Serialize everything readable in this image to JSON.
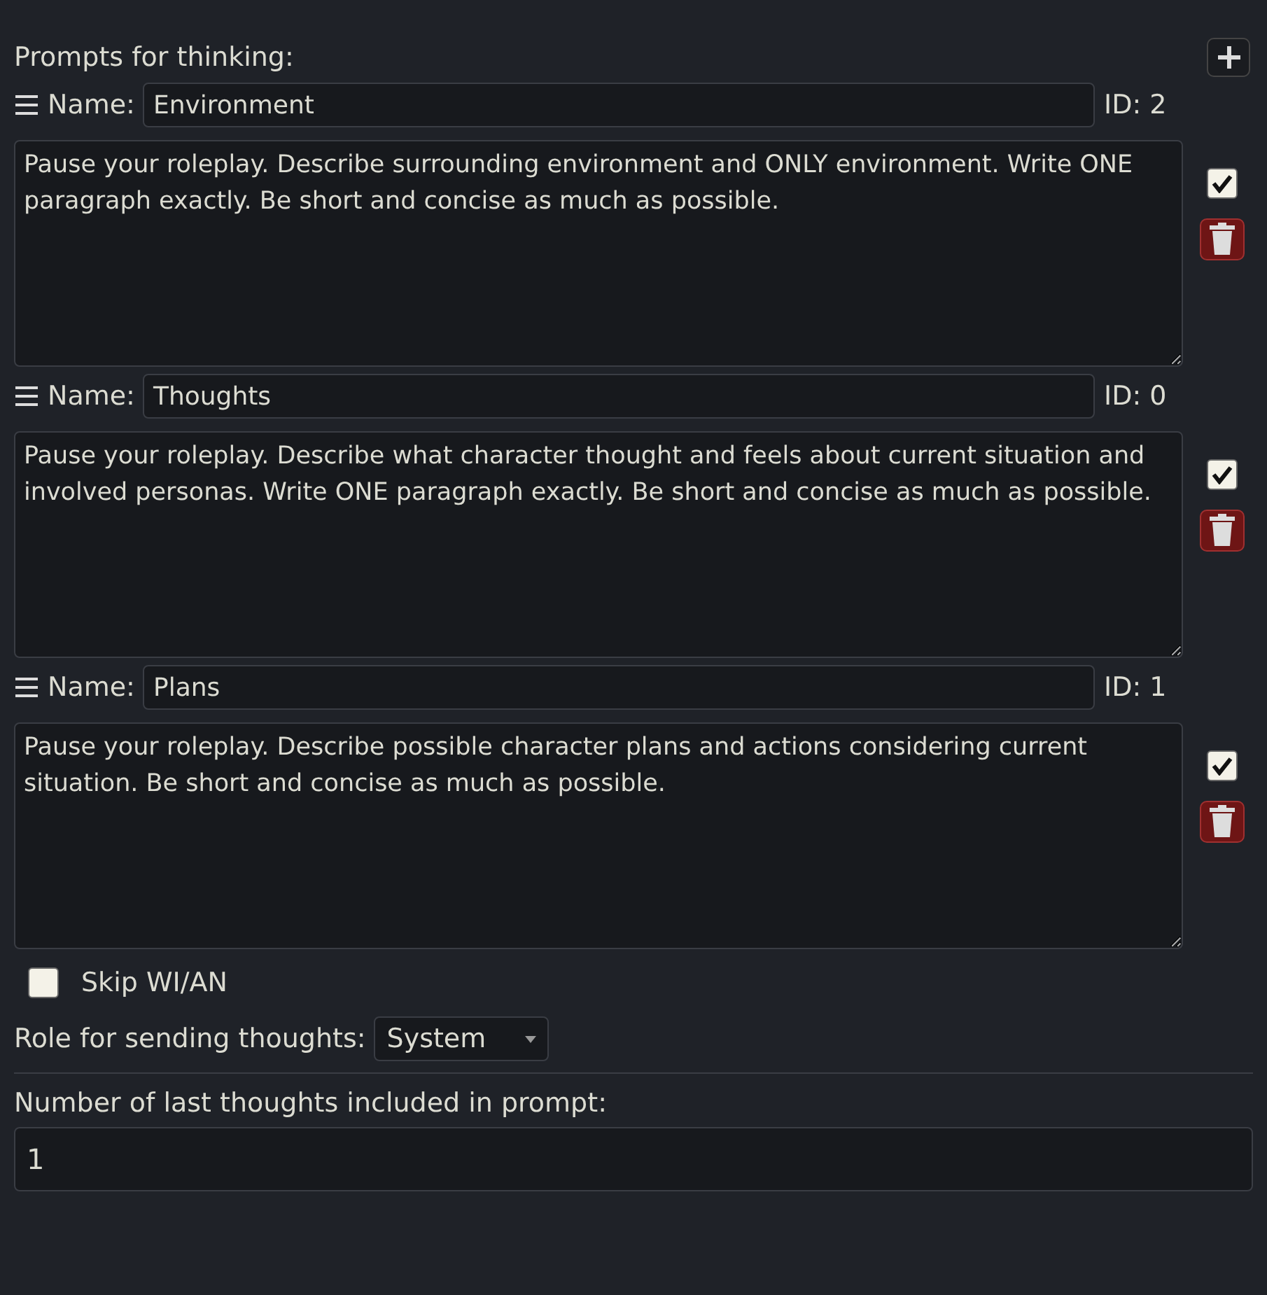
{
  "header": {
    "title": "Prompts for thinking:"
  },
  "prompts": [
    {
      "name_label": "Name:",
      "name": "Environment",
      "id": "ID: 2",
      "text": "Pause your roleplay. Describe surrounding environment and ONLY environment. Write ONE paragraph exactly. Be short and concise as much as possible.",
      "enabled": true
    },
    {
      "name_label": "Name:",
      "name": "Thoughts",
      "id": "ID: 0",
      "text": "Pause your roleplay. Describe what character thought and feels about current situation and involved personas. Write ONE paragraph exactly. Be short and concise as much as possible.",
      "enabled": true
    },
    {
      "name_label": "Name:",
      "name": "Plans",
      "id": "ID: 1",
      "text": "Pause your roleplay. Describe possible character plans and actions considering current situation. Be short and concise as much as possible.",
      "enabled": true
    }
  ],
  "skip_wi_an": {
    "label": "Skip WI/AN",
    "checked": false
  },
  "role": {
    "label": "Role for sending thoughts:",
    "value": "System"
  },
  "last_thoughts": {
    "label": "Number of last thoughts included in prompt:",
    "value": "1"
  }
}
